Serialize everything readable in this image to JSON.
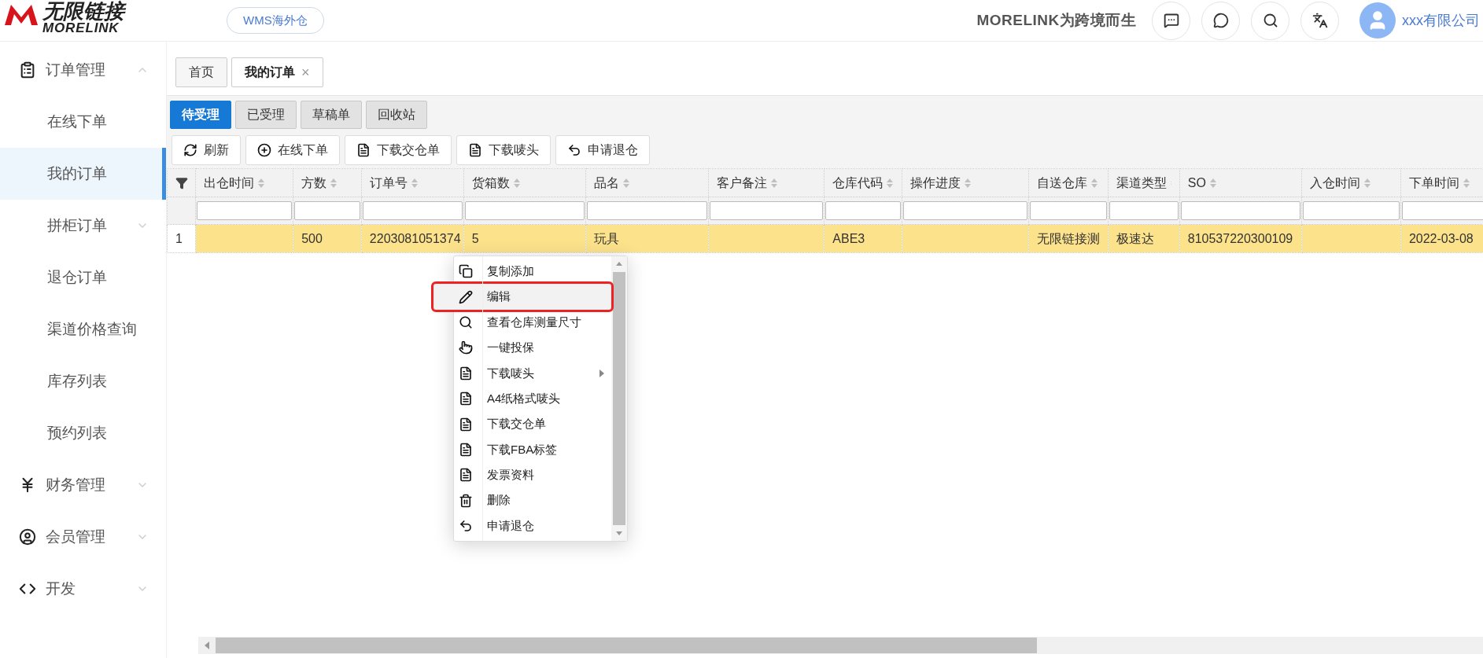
{
  "header": {
    "logo_cn": "无限链接",
    "logo_en": "MORELINK",
    "badge": "WMS海外仓",
    "slogan": "MORELINK为跨境而生",
    "icons": [
      {
        "kind": "chat"
      },
      {
        "kind": "wechat"
      },
      {
        "kind": "search"
      },
      {
        "kind": "translate"
      }
    ],
    "user": "xxx有限公司"
  },
  "sidebar": {
    "items": [
      {
        "label": "订单管理",
        "kind": "list",
        "expanded": true,
        "children": [
          {
            "label": "在线下单",
            "selected": false
          },
          {
            "label": "我的订单",
            "selected": true
          },
          {
            "label": "拼柜订单",
            "selected": false,
            "expanded": false
          },
          {
            "label": "退仓订单",
            "selected": false
          },
          {
            "label": "渠道价格查询",
            "selected": false
          },
          {
            "label": "库存列表",
            "selected": false
          },
          {
            "label": "预约列表",
            "selected": false
          }
        ]
      },
      {
        "label": "财务管理",
        "kind": "yen",
        "expanded": false
      },
      {
        "label": "会员管理",
        "kind": "user",
        "expanded": false
      },
      {
        "label": "开发",
        "kind": "code",
        "expanded": false
      }
    ]
  },
  "page_tabs": [
    {
      "label": "首页",
      "selected": false,
      "closable": false
    },
    {
      "label": "我的订单",
      "selected": true,
      "closable": true,
      "close": "×"
    }
  ],
  "status_tabs": [
    {
      "label": "待受理",
      "selected": true
    },
    {
      "label": "已受理",
      "selected": false
    },
    {
      "label": "草稿单",
      "selected": false
    },
    {
      "label": "回收站",
      "selected": false
    }
  ],
  "toolbar": [
    {
      "label": "刷新",
      "kind": "refresh"
    },
    {
      "label": "在线下单",
      "kind": "plus"
    },
    {
      "label": "下载交仓单",
      "kind": "file"
    },
    {
      "label": "下载唛头",
      "kind": "file"
    },
    {
      "label": "申请退仓",
      "kind": "reply"
    }
  ],
  "table": {
    "columns": [
      "出仓时间",
      "方数",
      "订单号",
      "货箱数",
      "品名",
      "客户备注",
      "仓库代码",
      "操作进度",
      "自送仓库",
      "渠道类型",
      "SO",
      "入仓时间",
      "下单时间"
    ],
    "rows": [
      {
        "index": "1",
        "selected": true,
        "cells": [
          "",
          "500",
          "2203081051374",
          "5",
          "玩具",
          "",
          "ABE3",
          "",
          "无限链接测",
          "极速达",
          "810537220300109",
          "",
          "2022-03-08"
        ]
      }
    ]
  },
  "context_menu": [
    {
      "label": "复制添加",
      "kind": "copy",
      "selected": false,
      "submenu": false
    },
    {
      "label": "编辑",
      "kind": "pencil",
      "selected": true,
      "submenu": false
    },
    {
      "label": "查看仓库测量尺寸",
      "kind": "search",
      "selected": false,
      "submenu": false
    },
    {
      "label": "一键投保",
      "kind": "hand",
      "selected": false,
      "submenu": false
    },
    {
      "label": "下载唛头",
      "kind": "file",
      "selected": false,
      "submenu": true
    },
    {
      "label": "A4纸格式唛头",
      "kind": "file",
      "selected": false,
      "submenu": false
    },
    {
      "label": "下载交仓单",
      "kind": "file",
      "selected": false,
      "submenu": false
    },
    {
      "label": "下载FBA标签",
      "kind": "file",
      "selected": false,
      "submenu": false
    },
    {
      "label": "发票资料",
      "kind": "file",
      "selected": false,
      "submenu": false
    },
    {
      "label": "删除",
      "kind": "trash",
      "selected": false,
      "submenu": false
    },
    {
      "label": "申请退仓",
      "kind": "reply",
      "selected": false,
      "submenu": false
    }
  ]
}
